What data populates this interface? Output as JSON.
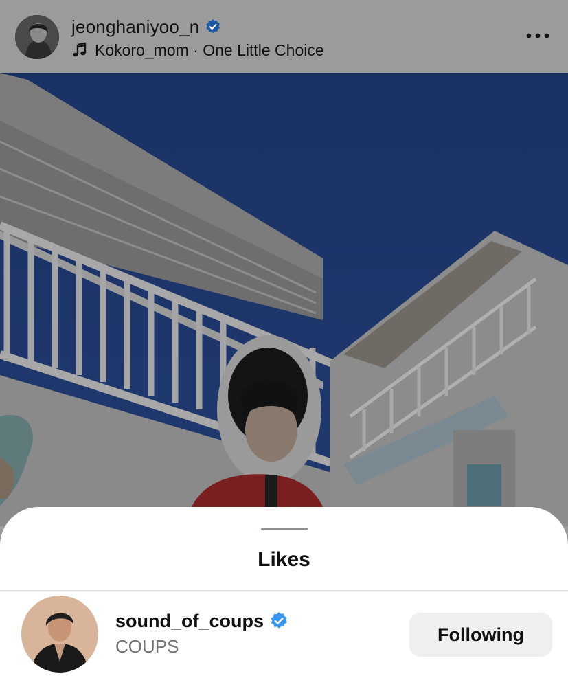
{
  "post": {
    "username": "jeonghaniyoo_n",
    "audio": "Kokoro_mom · One Little Choice",
    "icons": {
      "verified": "verified-badge-icon",
      "music": "music-note-icon",
      "more": "more-options-icon"
    }
  },
  "likes_sheet": {
    "title": "Likes",
    "likers": [
      {
        "username": "sound_of_coups",
        "full_name": "COUPS",
        "verified": true,
        "follow_state": "Following"
      }
    ]
  },
  "colors": {
    "verified_blue": "#3897f0",
    "sky": "#1c3466",
    "button_bg": "#efeff0"
  }
}
